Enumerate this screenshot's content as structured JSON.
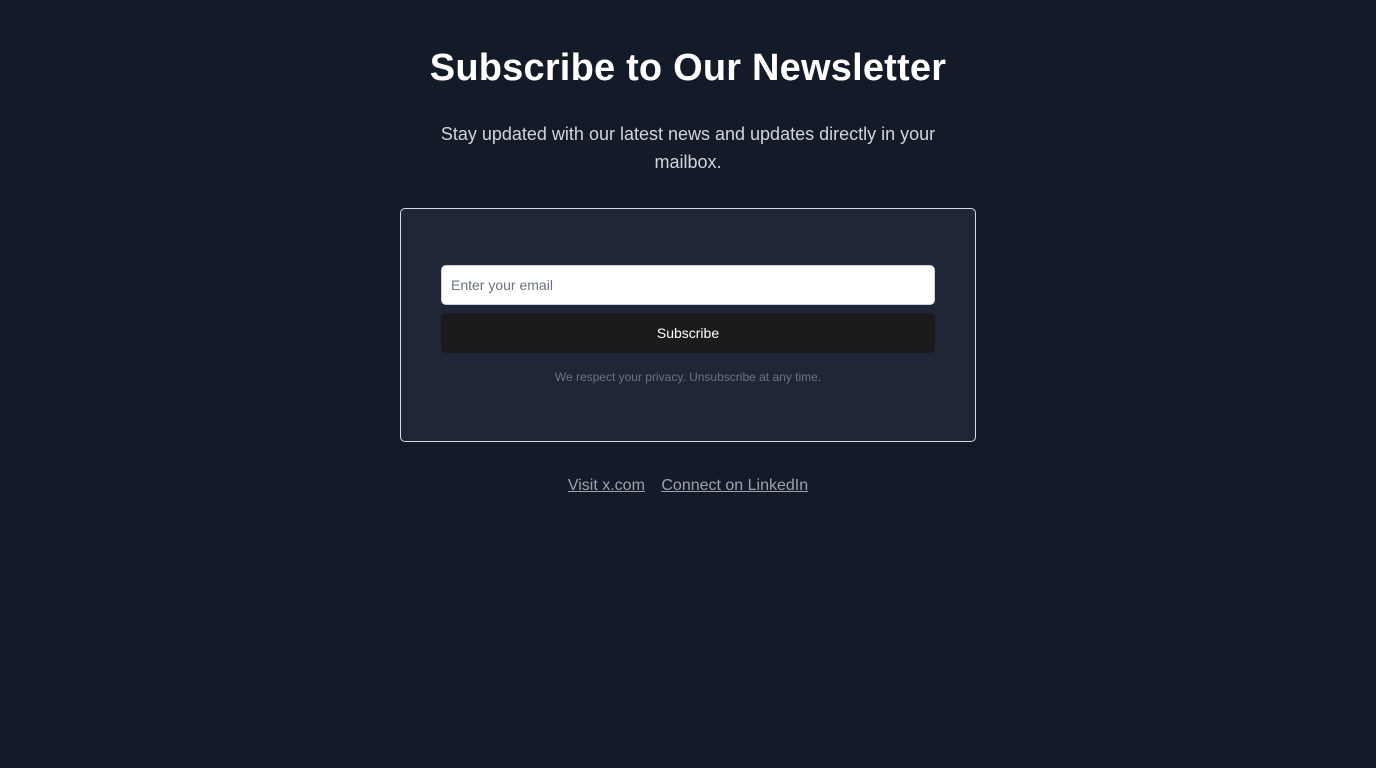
{
  "header": {
    "title": "Subscribe to Our Newsletter",
    "subtitle": "Stay updated with our latest news and updates directly in your mailbox."
  },
  "form": {
    "email_placeholder": "Enter your email",
    "email_value": "",
    "subscribe_label": "Subscribe",
    "privacy_note": "We respect your privacy. Unsubscribe at any time."
  },
  "links": [
    {
      "label": "Visit x.com"
    },
    {
      "label": "Connect on LinkedIn"
    }
  ],
  "colors": {
    "background": "#131a28",
    "card_background": "#1f2737",
    "button_background": "#1b1b1d",
    "link": "#9ca3af"
  }
}
